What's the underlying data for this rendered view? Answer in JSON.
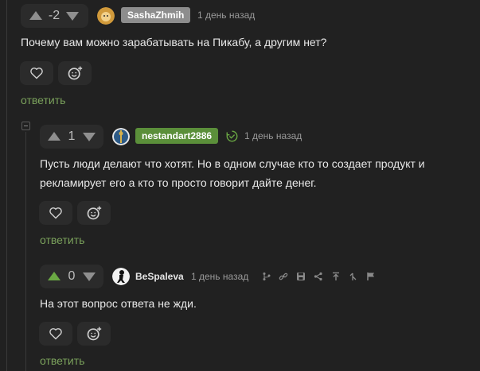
{
  "comments": [
    {
      "rating": "-2",
      "user": "SashaZhmih",
      "time": "1 день назад",
      "text": "Почему вам можно зарабатывать на Пикабу, а другим нет?",
      "reply": "ответить"
    },
    {
      "rating": "1",
      "user": "nestandart2886",
      "time": "1 день назад",
      "text": "Пусть люди делают что хотят. Но в одном случае кто то создает продукт и рекламирует его а кто то просто говорит дайте денег.",
      "reply": "ответить"
    },
    {
      "rating": "0",
      "user": "BeSpaleva",
      "time": "1 день назад",
      "text": "На этот вопрос ответа не жди.",
      "reply": "ответить"
    }
  ],
  "colors": {
    "accent": "#7ba25c",
    "upvote_active": "#6aa843",
    "user_badge_gray": "#8d8d8d",
    "user_badge_green": "#5b8f3a"
  },
  "icons": [
    "upvote-icon",
    "downvote-icon",
    "heart-icon",
    "emoji-icon",
    "verified-icon",
    "toolbar-icons"
  ]
}
